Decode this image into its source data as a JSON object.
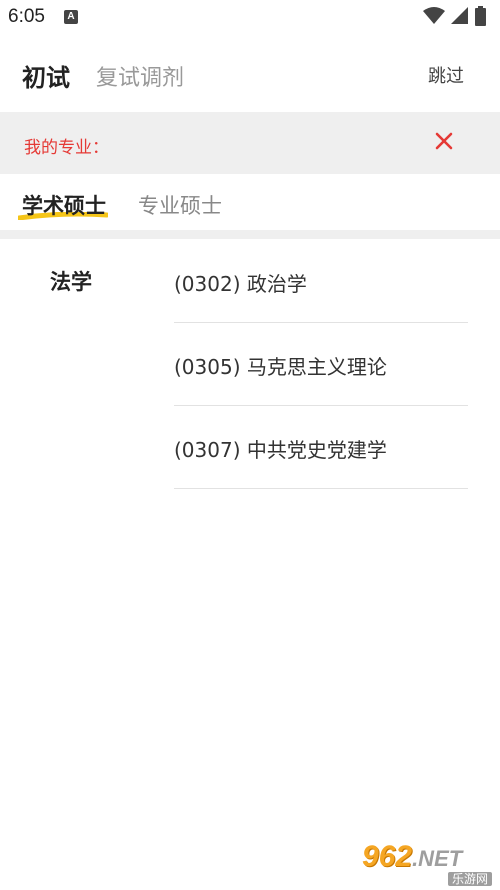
{
  "status_bar": {
    "time": "6:05",
    "notification_glyph": "A",
    "icons": [
      "wifi-icon",
      "signal-icon",
      "battery-icon"
    ]
  },
  "header": {
    "tab_main": "初试",
    "tab_secondary": "复试调剂",
    "skip_label": "跳过"
  },
  "major_bar": {
    "label": "我的专业：",
    "close_icon": "close-icon",
    "accent_color": "#e53935"
  },
  "degree_tabs": {
    "active": "学术硕士",
    "inactive": "专业硕士",
    "underline_color": "#f5c518"
  },
  "content": {
    "category": "法学",
    "majors": [
      "(0302) 政治学",
      "(0305) 马克思主义理论",
      "(0307) 中共党史党建学"
    ]
  },
  "watermark": {
    "brand": "962",
    "suffix": ".NET",
    "subtitle": "乐游网"
  }
}
